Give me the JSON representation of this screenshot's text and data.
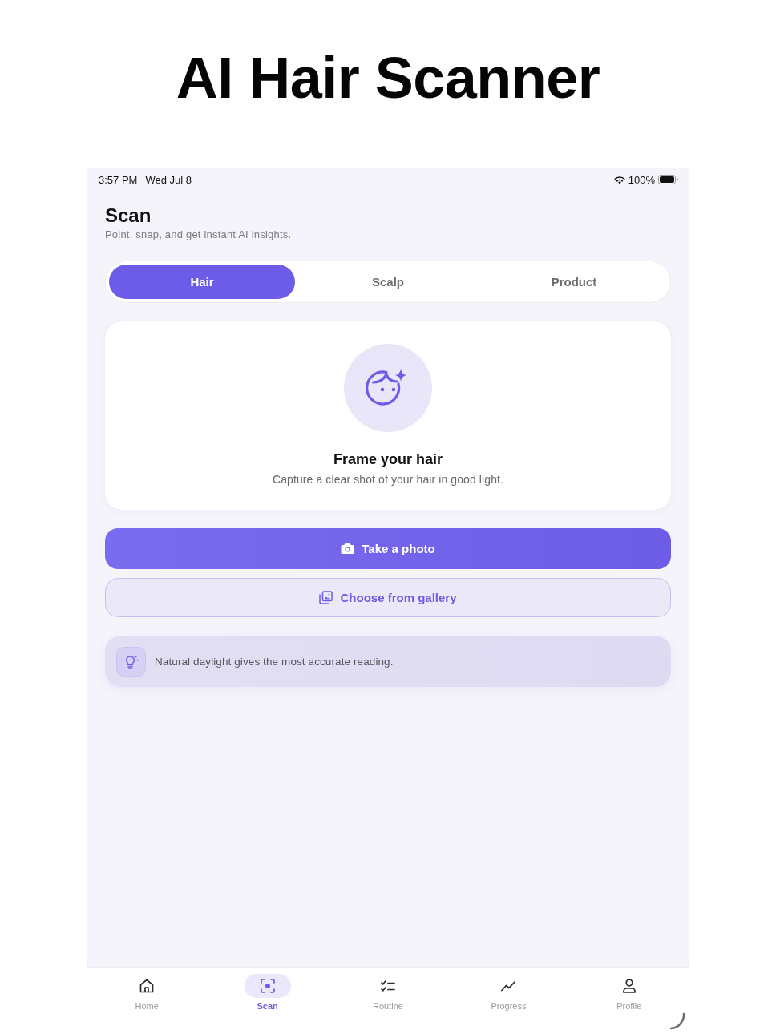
{
  "headline": "AI Hair Scanner",
  "status_bar": {
    "time": "3:57 PM",
    "date": "Wed Jul 8",
    "battery": "100%"
  },
  "header": {
    "title": "Scan",
    "subtitle": "Point, snap, and get instant AI insights."
  },
  "tabs": [
    {
      "label": "Hair",
      "selected": true
    },
    {
      "label": "Scalp",
      "selected": false
    },
    {
      "label": "Product",
      "selected": false
    }
  ],
  "prompt_card": {
    "title": "Frame your hair",
    "subtitle": "Capture a clear shot of your hair in good light."
  },
  "actions": [
    {
      "kind": "primary",
      "label": "Take a photo"
    },
    {
      "kind": "secondary",
      "label": "Choose from gallery"
    }
  ],
  "tip": {
    "text": "Natural daylight gives the most accurate reading."
  },
  "tab_bar": [
    {
      "label": "Home",
      "selected": false
    },
    {
      "label": "Scan",
      "selected": true
    },
    {
      "label": "Routine",
      "selected": false
    },
    {
      "label": "Progress",
      "selected": false
    },
    {
      "label": "Profile",
      "selected": false
    }
  ]
}
